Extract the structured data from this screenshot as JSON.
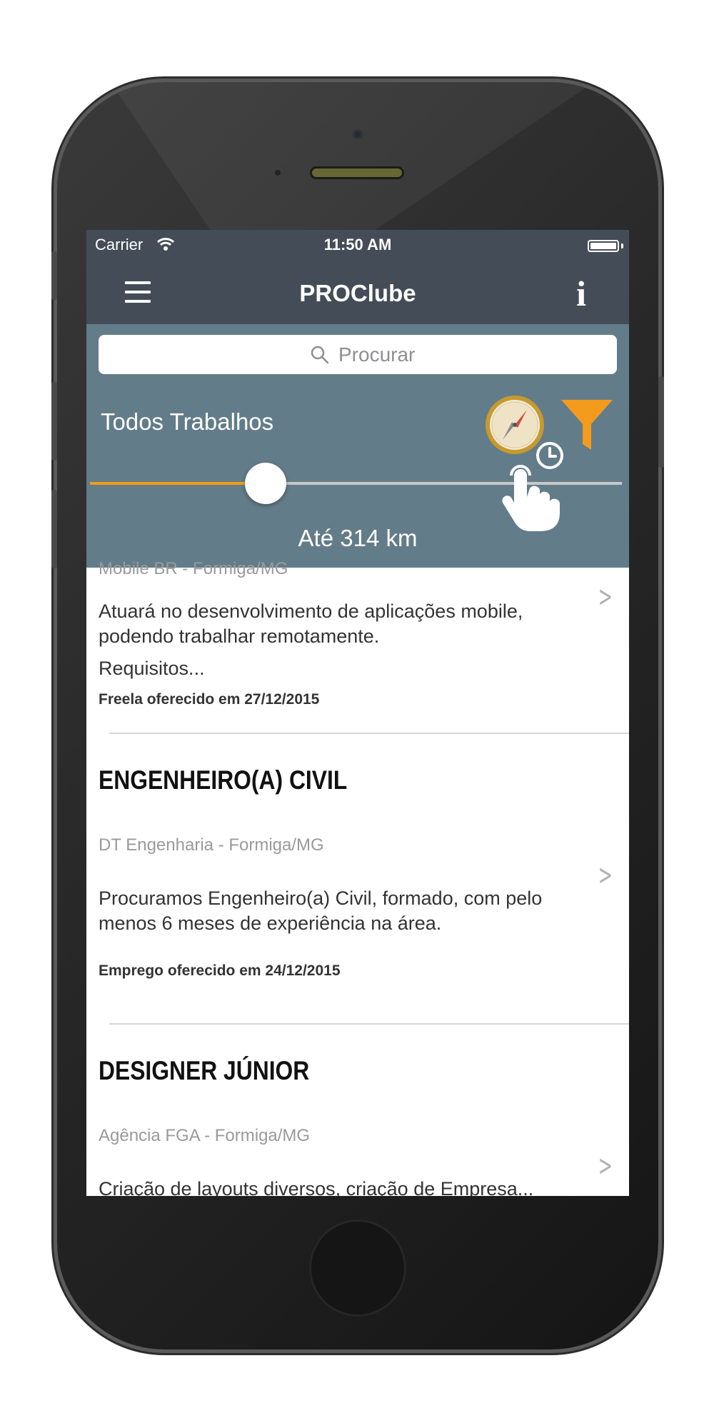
{
  "status_bar": {
    "carrier": "Carrier",
    "time": "11:50 AM"
  },
  "nav": {
    "title": "PROClube",
    "info_glyph": "i"
  },
  "search": {
    "placeholder": "Procurar"
  },
  "filter": {
    "title": "Todos Trabalhos",
    "distance_label": "Até 314 km",
    "slider_level_fraction": 0.33,
    "accent_color": "#f29b1d",
    "icons": [
      "compass-icon",
      "funnel-icon",
      "tap-hand-icon"
    ]
  },
  "jobs": [
    {
      "title": "",
      "company": "Mobile BR - Formiga/MG",
      "description": "Atuará no desenvolvimento de aplicações mobile, podendo trabalhar remotamente.",
      "extra": "Requisitos...",
      "offered": "Freela oferecido em 27/12/2015"
    },
    {
      "title": "ENGENHEIRO(A) CIVIL",
      "company": "DT Engenharia - Formiga/MG",
      "description": "Procuramos Engenheiro(a) Civil, formado, com pelo menos 6 meses de experiência na área.",
      "offered": "Emprego oferecido em 24/12/2015"
    },
    {
      "title": "DESIGNER JÚNIOR",
      "company": "Agência FGA - Formiga/MG",
      "description": "Criação de layouts diversos, criação de Empresa...",
      "offered": ""
    }
  ],
  "colors": {
    "header": "#444d57",
    "panel": "#637c89",
    "orange": "#f29b1d"
  }
}
